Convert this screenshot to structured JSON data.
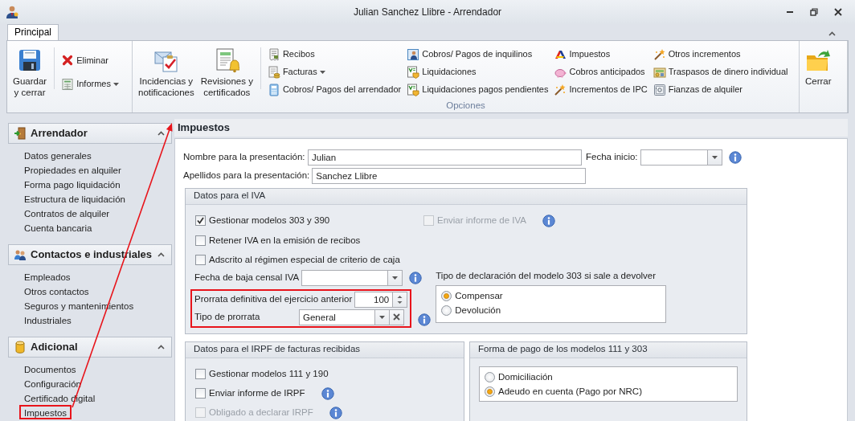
{
  "window": {
    "title": "Julian Sanchez Llibre - Arrendador"
  },
  "tabs": [
    {
      "label": "Principal",
      "selected": true
    }
  ],
  "ribbon": {
    "groups": [
      {
        "items": [
          {
            "kind": "large",
            "label": "Guardar\ny cerrar"
          },
          {
            "kind": "stack",
            "items": [
              {
                "label": "Eliminar",
                "dropdown": false
              },
              {
                "label": "Informes",
                "dropdown": true
              }
            ]
          }
        ]
      },
      {
        "label": "Opciones",
        "items": [
          {
            "kind": "large",
            "label": "Incidencias y\nnotificaciones"
          },
          {
            "kind": "large",
            "label": "Revisiones y\ncertificados"
          },
          {
            "kind": "stack",
            "items": [
              {
                "label": "Recibos",
                "dropdown": false
              },
              {
                "label": "Facturas",
                "dropdown": true
              },
              {
                "label": "Cobros/ Pagos del arrendador",
                "dropdown": false
              }
            ]
          },
          {
            "kind": "stack",
            "items": [
              {
                "label": "Cobros/ Pagos de inquilinos",
                "dropdown": false
              },
              {
                "label": "Liquidaciones",
                "dropdown": false
              },
              {
                "label": "Liquidaciones pagos pendientes",
                "dropdown": false
              }
            ]
          },
          {
            "kind": "stack",
            "items": [
              {
                "label": "Impuestos",
                "dropdown": false
              },
              {
                "label": "Cobros anticipados",
                "dropdown": false
              },
              {
                "label": "Incrementos de IPC",
                "dropdown": false
              }
            ]
          },
          {
            "kind": "stack",
            "items": [
              {
                "label": "Otros incrementos",
                "dropdown": false
              },
              {
                "label": "Traspasos de dinero individual",
                "dropdown": false
              },
              {
                "label": "Fianzas de alquiler",
                "dropdown": false
              }
            ]
          }
        ]
      },
      {
        "items": [
          {
            "kind": "large",
            "label": "Cerrar"
          }
        ]
      }
    ]
  },
  "sidebar": {
    "sections": [
      {
        "title": "Arrendador",
        "expanded": true,
        "items": [
          {
            "label": "Datos generales",
            "highlighted": false
          },
          {
            "label": "Propiedades en alquiler",
            "highlighted": false
          },
          {
            "label": "Forma pago liquidación",
            "highlighted": false
          },
          {
            "label": "Estructura de liquidación",
            "highlighted": false
          },
          {
            "label": "Contratos de alquiler",
            "highlighted": false
          },
          {
            "label": "Cuenta bancaria",
            "highlighted": false
          }
        ]
      },
      {
        "title": "Contactos e industriales",
        "expanded": true,
        "items": [
          {
            "label": "Empleados",
            "highlighted": false
          },
          {
            "label": "Otros contactos",
            "highlighted": false
          },
          {
            "label": "Seguros y mantenimientos",
            "highlighted": false
          },
          {
            "label": "Industriales",
            "highlighted": false
          }
        ]
      },
      {
        "title": "Adicional",
        "expanded": true,
        "items": [
          {
            "label": "Documentos",
            "highlighted": false
          },
          {
            "label": "Configuración",
            "highlighted": false
          },
          {
            "label": "Certificado digital",
            "highlighted": false
          },
          {
            "label": "Impuestos",
            "highlighted": true
          }
        ]
      }
    ]
  },
  "content": {
    "title": "Impuestos",
    "name": {
      "label": "Nombre para la presentación:",
      "value": "Julian"
    },
    "surname": {
      "label": "Apellidos para la presentación:",
      "value": "Sanchez Llibre"
    },
    "start_date": {
      "label": "Fecha inicio:"
    },
    "iva": {
      "title": "Datos para el IVA",
      "check_rows": [
        [
          {
            "label": "Gestionar modelos 303 y 390",
            "checked": true,
            "disabled": false,
            "info": false
          },
          {
            "label": "Enviar informe de IVA",
            "checked": false,
            "disabled": true,
            "info": true
          }
        ],
        [
          {
            "label": "Retener IVA en la emisión de recibos",
            "checked": false,
            "disabled": false,
            "info": false
          }
        ],
        [
          {
            "label": "Adscrito al régimen especial de criterio de caja",
            "checked": false,
            "disabled": false,
            "info": false
          }
        ]
      ],
      "leave_date": {
        "label": "Fecha de baja censal IVA"
      },
      "prorrata": {
        "highlighted": true,
        "percent": {
          "label": "Prorrata definitiva del ejercicio anterior",
          "value": "100"
        },
        "type": {
          "label": "Tipo de prorrata",
          "value": "General"
        }
      },
      "refund": {
        "label": "Tipo de declaración del modelo 303 si sale a devolver",
        "options": [
          {
            "label": "Compensar",
            "selected": true
          },
          {
            "label": "Devolución",
            "selected": false
          }
        ]
      }
    },
    "irpf": {
      "title": "Datos para el IRPF de facturas recibidas",
      "checks": [
        {
          "label": "Gestionar modelos 111 y 190",
          "checked": false,
          "disabled": false,
          "info": false
        },
        {
          "label": "Enviar informe de IRPF",
          "checked": false,
          "disabled": false,
          "info": true
        },
        {
          "label": "Obligado a declarar IRPF",
          "checked": false,
          "disabled": true,
          "info": true
        }
      ]
    },
    "payment": {
      "title": "Forma de pago de los modelos 111 y 303",
      "options": [
        {
          "label": "Domiciliación",
          "selected": false
        },
        {
          "label": "Adeudo en cuenta (Pago por NRC)",
          "selected": true
        }
      ]
    }
  },
  "annotation": {
    "arrow": true
  }
}
